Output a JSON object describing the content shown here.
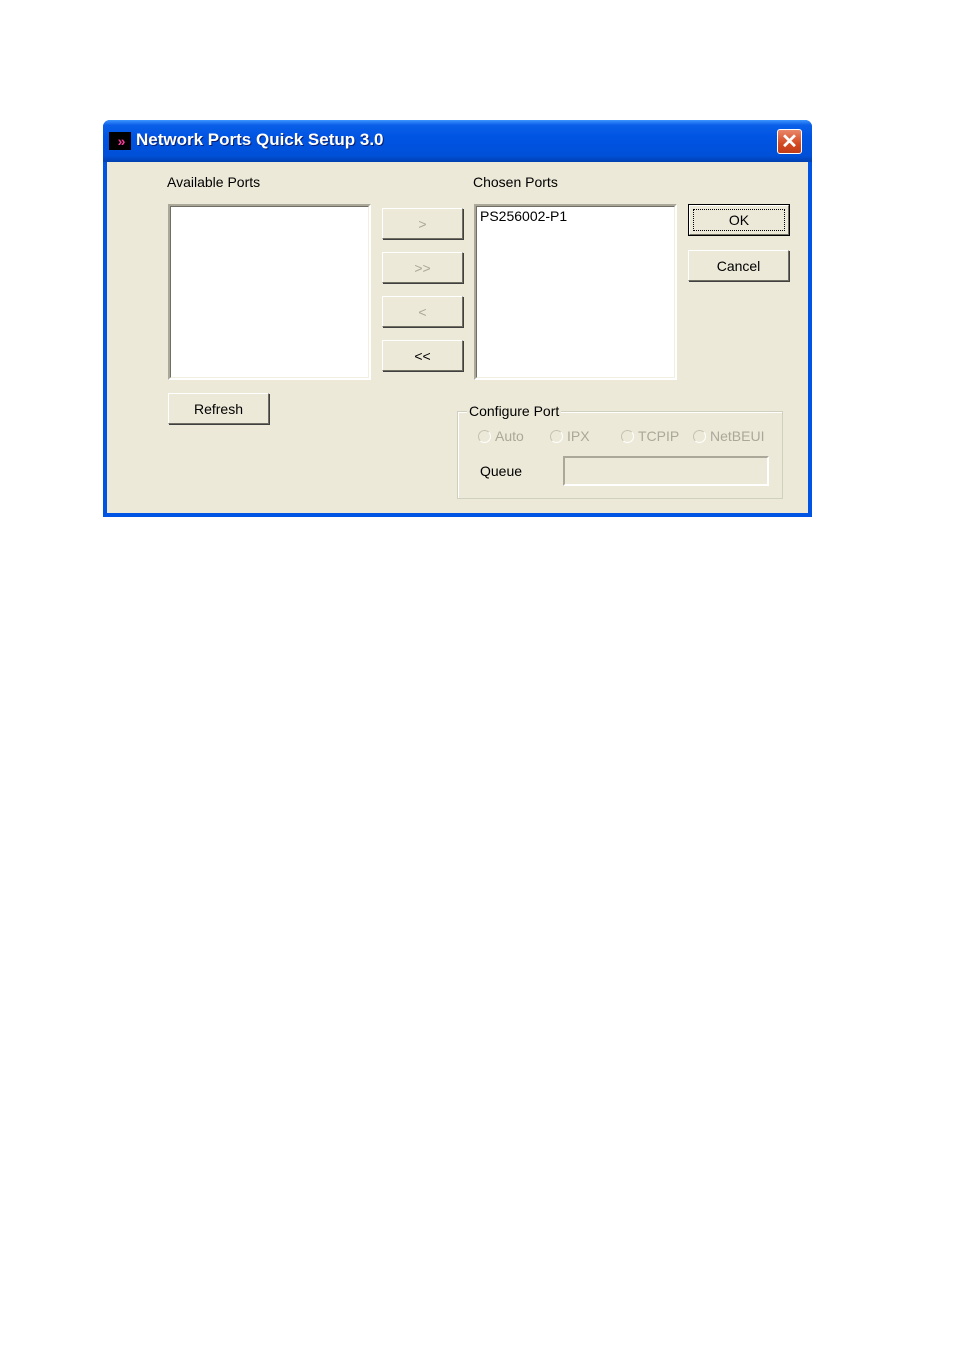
{
  "window": {
    "title": "Network Ports Quick Setup 3.0",
    "app_icon": "»",
    "close_glyph": "✕"
  },
  "available": {
    "label": "Available Ports",
    "items": []
  },
  "chosen": {
    "label": "Chosen Ports",
    "items": [
      "PS256002-P1"
    ]
  },
  "transfer_buttons": {
    "add": ">",
    "add_all": ">>",
    "remove": "<",
    "remove_all": "<<"
  },
  "buttons": {
    "ok": "OK",
    "cancel": "Cancel",
    "refresh": "Refresh"
  },
  "configure_port": {
    "label": "Configure Port",
    "protocols": [
      "Auto",
      "IPX",
      "TCPIP",
      "NetBEUI"
    ],
    "queue_label": "Queue",
    "queue_value": ""
  }
}
